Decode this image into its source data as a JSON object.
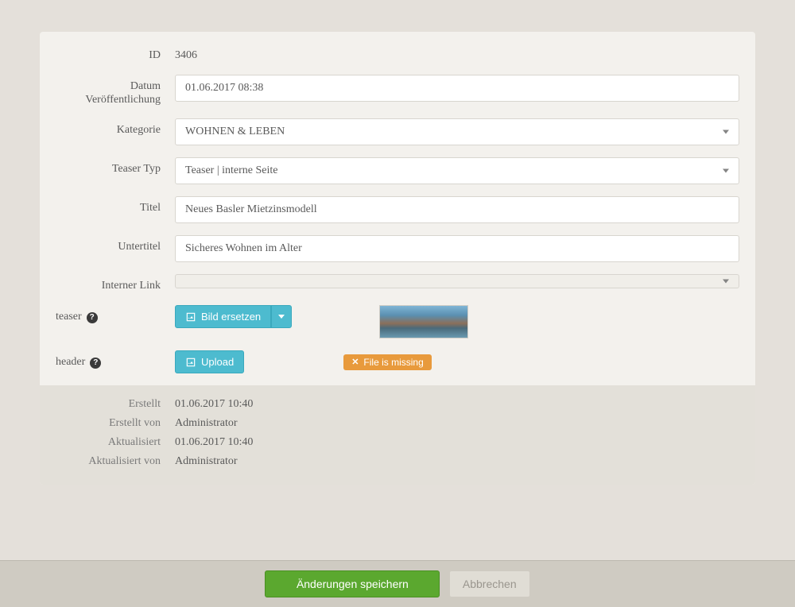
{
  "fields": {
    "id": {
      "label": "ID",
      "value": "3406"
    },
    "publish_date": {
      "label": "Datum Veröffentlichung",
      "value": "01.06.2017 08:38"
    },
    "category": {
      "label": "Kategorie",
      "value": "WOHNEN & LEBEN"
    },
    "teaser_type": {
      "label": "Teaser Typ",
      "value": "Teaser | interne Seite"
    },
    "title": {
      "label": "Titel",
      "value": "Neues Basler Mietzinsmodell"
    },
    "subtitle": {
      "label": "Untertitel",
      "value": "Sicheres Wohnen im Alter"
    },
    "internal_link": {
      "label": "Interner Link",
      "value": ""
    },
    "teaser": {
      "label": "teaser",
      "button": "Bild ersetzen"
    },
    "header": {
      "label": "header",
      "button": "Upload",
      "warning": "File is missing"
    }
  },
  "meta": {
    "created": {
      "label": "Erstellt",
      "value": "01.06.2017 10:40"
    },
    "created_by": {
      "label": "Erstellt von",
      "value": "Administrator"
    },
    "updated": {
      "label": "Aktualisiert",
      "value": "01.06.2017 10:40"
    },
    "updated_by": {
      "label": "Aktualisiert von",
      "value": "Administrator"
    }
  },
  "actions": {
    "save": "Änderungen speichern",
    "cancel": "Abbrechen"
  }
}
